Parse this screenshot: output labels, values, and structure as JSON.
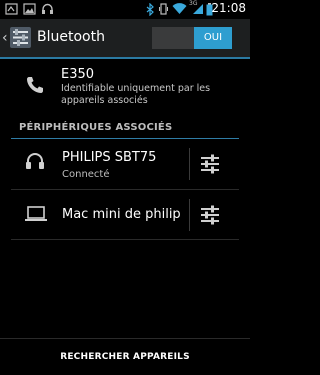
{
  "status_bar": {
    "time": "21:08",
    "network_label": "3G"
  },
  "action_bar": {
    "title": "Bluetooth",
    "toggle_label": "OUI"
  },
  "this_device": {
    "name": "E350",
    "description": "Identifiable uniquement par les appareils associés"
  },
  "paired": {
    "header": "PÉRIPHÉRIQUES ASSOCIÉS",
    "devices": [
      {
        "name": "PHILIPS SBT75",
        "status": "Connecté",
        "icon": "headphones-icon"
      },
      {
        "name": "Mac mini de philip",
        "status": "",
        "icon": "laptop-icon"
      }
    ]
  },
  "footer": {
    "search_label": "RECHERCHER APPAREILS"
  },
  "colors": {
    "accent": "#2e9ed0",
    "divider": "#2f7da6",
    "action_bar_bg": "#1d1f20"
  }
}
